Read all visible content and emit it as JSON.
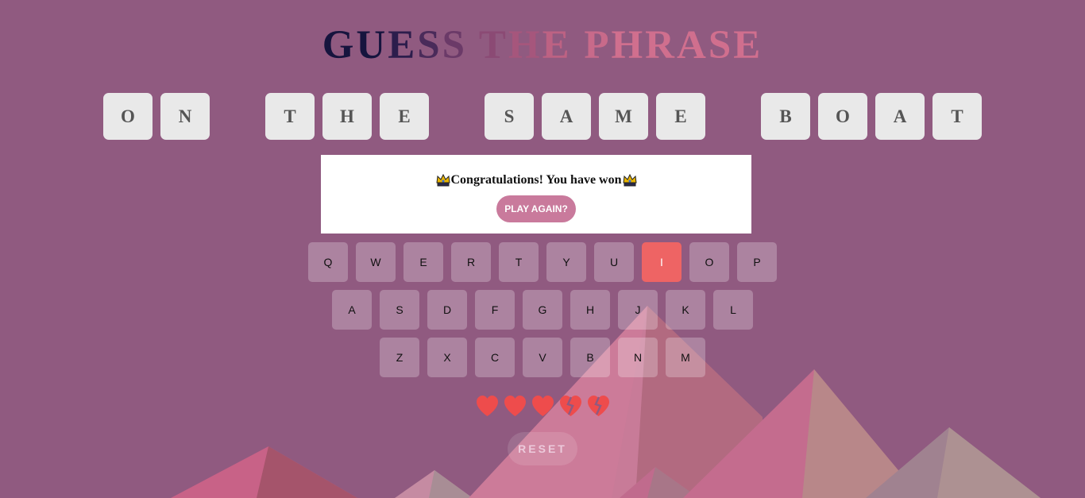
{
  "title": "GUESS THE PHRASE",
  "title_colors": [
    "#16143e",
    "#2c1d4c",
    "#4a2b5a",
    "#6b3a68",
    "#8b4a74",
    "#a6567c",
    "#bd6283",
    "#c86a8a",
    "#d06f8e"
  ],
  "phrase_words": [
    [
      "O",
      "N"
    ],
    [
      "T",
      "H",
      "E"
    ],
    [
      "S",
      "A",
      "M",
      "E"
    ],
    [
      "B",
      "O",
      "A",
      "T"
    ]
  ],
  "banner": {
    "message": "Congratulations! You have won",
    "crown_icon": "crown-icon",
    "play_again_label": "PLAY AGAIN?"
  },
  "keyboard": {
    "rows": [
      [
        "Q",
        "W",
        "E",
        "R",
        "T",
        "Y",
        "U",
        "I",
        "O",
        "P"
      ],
      [
        "A",
        "S",
        "D",
        "F",
        "G",
        "H",
        "J",
        "K",
        "L"
      ],
      [
        "Z",
        "X",
        "C",
        "V",
        "B",
        "N",
        "M"
      ]
    ],
    "wrong_guesses": [
      "I"
    ],
    "wrong_color": "#ee6464"
  },
  "lives": {
    "total": 5,
    "remaining": 3,
    "heart_icon": "heart-icon",
    "lost_icon": "broken-heart-icon",
    "color": "#ee4c4c"
  },
  "reset_label": "RESET",
  "colors": {
    "background": "#905a80",
    "tile": "#e9e9e9",
    "accent": "#c97a9c"
  }
}
